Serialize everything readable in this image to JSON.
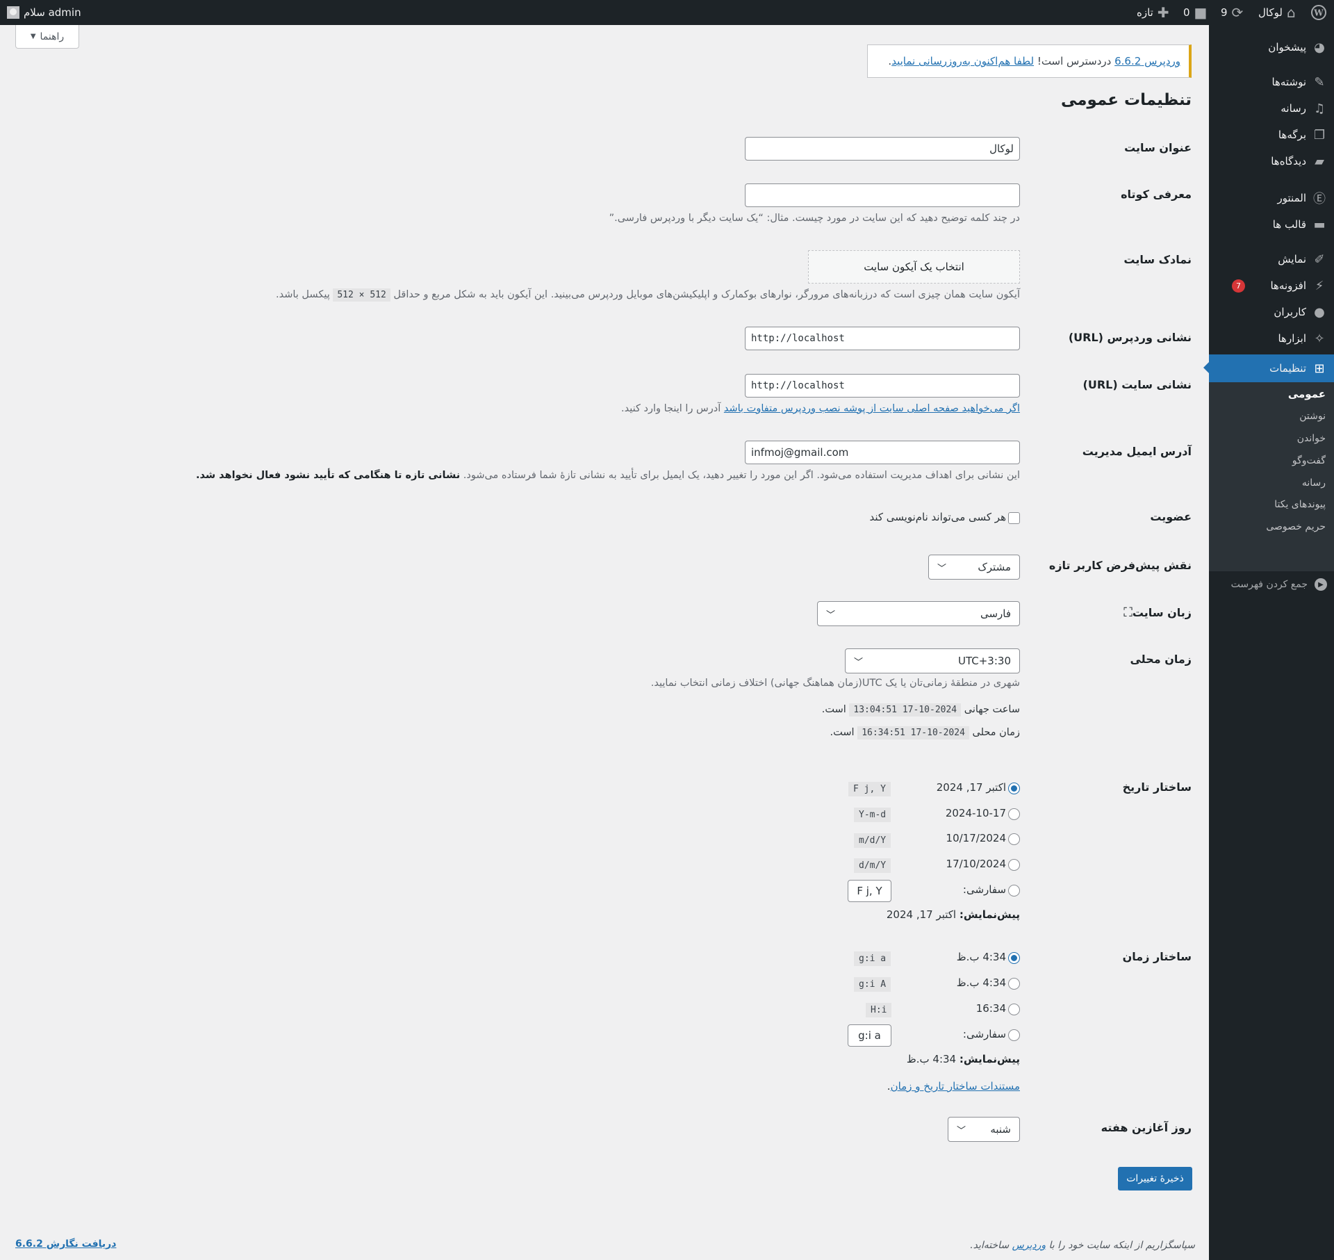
{
  "adminbar": {
    "site_name": "لوکال",
    "updates_count": "9",
    "comments_count": "0",
    "new_label": "تازه",
    "greeting": "سلام admin"
  },
  "sidebar": {
    "items": [
      {
        "label": "پیشخوان",
        "icon": "dashboard-icon"
      },
      {
        "label": "نوشته‌ها",
        "icon": "pin-icon"
      },
      {
        "label": "رسانه",
        "icon": "media-icon"
      },
      {
        "label": "برگه‌ها",
        "icon": "pages-icon"
      },
      {
        "label": "دیدگاه‌ها",
        "icon": "comments-icon"
      },
      {
        "label": "المنتور",
        "icon": "elementor-icon"
      },
      {
        "label": "قالب ها",
        "icon": "folder-icon"
      },
      {
        "label": "نمایش",
        "icon": "appearance-icon"
      },
      {
        "label": "افزونه‌ها",
        "icon": "plugins-icon",
        "badge": "7"
      },
      {
        "label": "کاربران",
        "icon": "users-icon"
      },
      {
        "label": "ابزارها",
        "icon": "tools-icon"
      },
      {
        "label": "تنظیمات",
        "icon": "settings-icon"
      }
    ],
    "submenu": [
      "عمومی",
      "نوشتن",
      "خواندن",
      "گفت‌وگو",
      "رسانه",
      "پیوندهای یکتا",
      "حریم خصوصی"
    ],
    "collapse_label": "جمع کردن فهرست"
  },
  "help_tab": "راهنما",
  "notice": {
    "link1": "وردپرس 6.6.2",
    "middle": " دردسترس است! ",
    "link2": "لطفا هم‌اکنون به‌روزرسانی نمایید",
    "end": "."
  },
  "page_title": "تنظیمات عمومی",
  "fields": {
    "site_title": {
      "label": "عنوان سایت",
      "value": "لوکال"
    },
    "tagline": {
      "label": "معرفی کوتاه",
      "value": "",
      "desc": "در چند کلمه توضیح دهید که این سایت در مورد چیست. مثال: “یک سایت دیگر با وردپرس فارسی.”"
    },
    "site_icon": {
      "label": "نمادک سایت",
      "button": "انتخاب یک آیکون سایت",
      "desc_before": "آیکون سایت همان چیزی است که درزبانه‌های مرورگر، نوارهای بوکمارک و اپلیکیشن‌های موبایل وردپرس می‌بینید. این آیکون باید به شکل مربع و حداقل ",
      "desc_code": "512 × 512",
      "desc_after": " پیکسل باشد."
    },
    "wp_url": {
      "label": "نشانی وردپرس (URL)",
      "value": "http://localhost"
    },
    "site_url": {
      "label": "نشانی سایت (URL)",
      "value": "http://localhost",
      "desc_link": "اگر می‌خواهید صفحه اصلی سایت از پوشه نصب وردپرس متفاوت باشد",
      "desc_after": " آدرس را اینجا وارد کنید."
    },
    "admin_email": {
      "label": "آدرس ایمیل مدیریت",
      "value": "infmoj@gmail.com",
      "desc": "این نشانی برای اهداف مدیریت استفاده می‌شود. اگر این مورد را تغییر دهید، یک ایمیل برای تأیید به نشانی تازهٔ شما فرستاده می‌شود. ",
      "desc_bold": "نشانی تازه تا هنگامی که تأیید نشود فعال نخواهد شد."
    },
    "membership": {
      "label": "عضویت",
      "checkbox": "هر کسی می‌تواند نام‌نویسی کند"
    },
    "default_role": {
      "label": "نقش پیش‌فرض کاربر تازه",
      "value": "مشترک"
    },
    "site_language": {
      "label": "زبان سایت",
      "value": "فارسی"
    },
    "timezone": {
      "label": "زمان محلی",
      "value": "UTC+3:30",
      "desc": "شهری در منطقهٔ زمانی‌تان یا یک UTC(زمان هماهنگ جهانی) اختلاف زمانی انتخاب نمایید.",
      "utc_before": "ساعت جهانی ",
      "utc_code": "2024-10-17 13:04:51",
      "utc_after": " است.",
      "local_before": "زمان محلی ",
      "local_code": "2024-10-17 16:34:51",
      "local_after": " است."
    },
    "date_format": {
      "label": "ساختار تاریخ",
      "options": [
        {
          "label": "اکتبر 17, 2024",
          "code": "F j, Y",
          "checked": true
        },
        {
          "label": "2024-10-17",
          "code": "Y-m-d",
          "checked": false
        },
        {
          "label": "10/17/2024",
          "code": "m/d/Y",
          "checked": false
        },
        {
          "label": "17/10/2024",
          "code": "d/m/Y",
          "checked": false
        }
      ],
      "custom_label": "سفارشی:",
      "custom_value": "F j, Y",
      "preview_label": "پیش‌نمایش:",
      "preview_value": " اکتبر 17, 2024"
    },
    "time_format": {
      "label": "ساختار زمان",
      "options": [
        {
          "label": "4:34 ب.ظ",
          "code": "g:i a",
          "checked": true
        },
        {
          "label": "4:34 ب.ظ",
          "code": "g:i A",
          "checked": false
        },
        {
          "label": "16:34",
          "code": "H:i",
          "checked": false
        }
      ],
      "custom_label": "سفارشی:",
      "custom_value": "g:i a",
      "preview_label": "پیش‌نمایش:",
      "preview_value": " 4:34 ب.ظ",
      "doc_link": "مستندات ساختار تاریخ و زمان",
      "doc_after": "."
    },
    "week_start": {
      "label": "روز آغازین هفته",
      "value": "شنبه"
    }
  },
  "save_button": "ذخیرهٔ تغییرات",
  "footer": {
    "thanks_before": "سپاسگزاریم از اینکه سایت خود را با ",
    "thanks_link": "وردپرس",
    "thanks_after": " ساخته‌اید.",
    "version_link": "دریافت نگارش 6.6.2"
  }
}
